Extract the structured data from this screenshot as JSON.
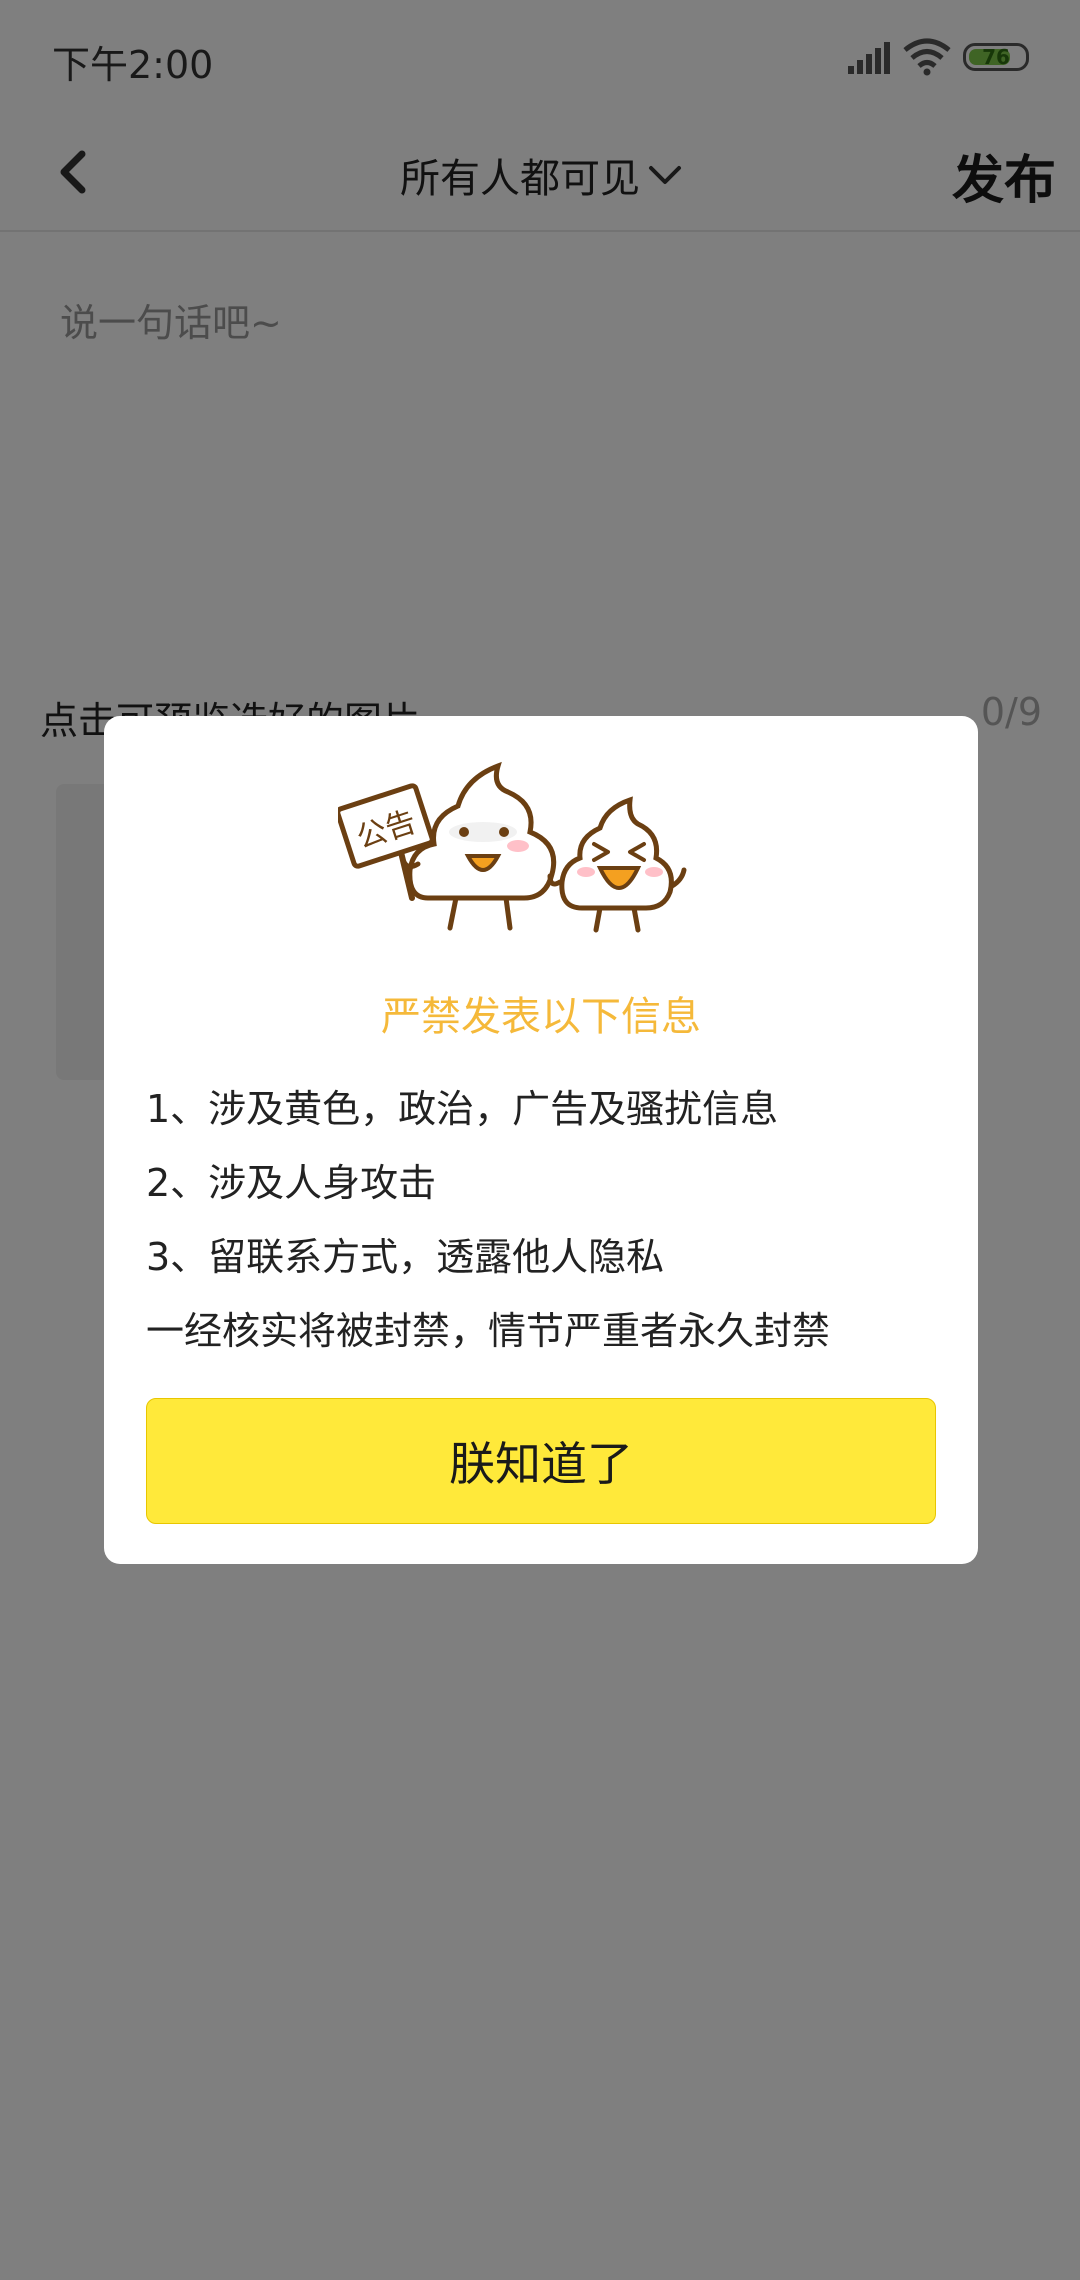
{
  "status_bar": {
    "time": "下午2:00",
    "battery": "76",
    "battery_level": 0.76,
    "icons": [
      "signal-icon",
      "wifi-icon",
      "battery-icon"
    ]
  },
  "header": {
    "back_icon": "chevron-left-icon",
    "visibility_label": "所有人都可见",
    "visibility_icon": "chevron-down-icon",
    "publish_label": "发布"
  },
  "compose": {
    "placeholder": "说一句话吧~",
    "preview_label": "点击可预览选好的图片",
    "counter": "0/9"
  },
  "modal": {
    "illustration": "mascot-illustration",
    "sign_text": "公告",
    "title": "严禁发表以下信息",
    "rules": [
      "1、涉及黄色，政治，广告及骚扰信息",
      "2、涉及人身攻击",
      "3、留联系方式，透露他人隐私",
      "一经核实将被封禁，情节严重者永久封禁"
    ],
    "ack_label": "朕知道了"
  },
  "colors": {
    "accent_yellow": "#ffe93a",
    "title_orange": "#f5b93a",
    "overlay": "#000000"
  }
}
